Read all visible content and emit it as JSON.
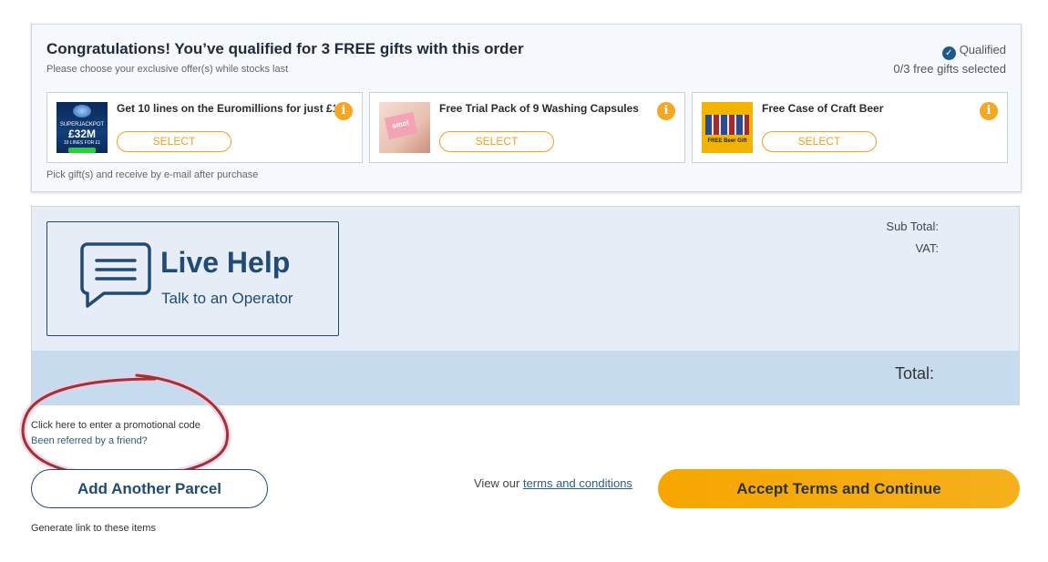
{
  "gifts": {
    "title": "Congratulations! You’ve qualified for 3 FREE gifts with this order",
    "subtitle": "Please choose your exclusive offer(s) while stocks last",
    "qualified_label": "Qualified",
    "selected_count": "0/3 free gifts selected",
    "footer": "Pick gift(s) and receive by e-mail after purchase",
    "items": [
      {
        "title": "Get 10 lines on the Euromillions for just £1.",
        "button": "SELECT",
        "thumb_text": [
          "SUPERJACKPOT",
          "£32M",
          "10 LINES FOR £1",
          ""
        ]
      },
      {
        "title": "Free Trial Pack of 9 Washing Capsules",
        "button": "SELECT",
        "thumb_text": [
          "smol"
        ]
      },
      {
        "title": "Free Case of Craft Beer",
        "button": "SELECT",
        "thumb_text": [
          "FREE Beer Gift"
        ]
      }
    ],
    "info_glyph": "i"
  },
  "summary": {
    "live_help_title": "Live Help",
    "live_help_sub": "Talk to an Operator",
    "sub_total_label": "Sub Total:",
    "vat_label": "VAT:",
    "total_label": "Total:"
  },
  "links": {
    "promo": "Click here to enter a promotional code",
    "referred": "Been referred by a friend?",
    "generate": "Generate link to these items"
  },
  "actions": {
    "add_parcel": "Add Another Parcel",
    "terms_prefix": "View our ",
    "terms_link": "terms and conditions",
    "accept": "Accept Terms and Continue"
  },
  "colors": {
    "accent": "#f5a623",
    "navy": "#1f4b75",
    "annotation": "#a0342a"
  }
}
